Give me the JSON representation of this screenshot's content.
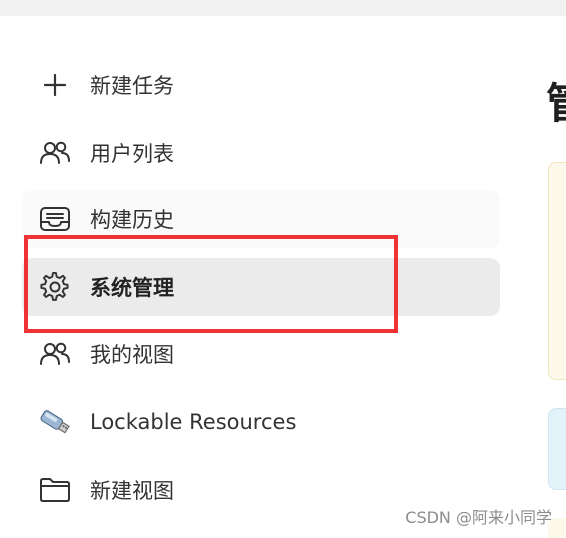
{
  "sidebar": {
    "items": [
      {
        "label": "新建任务",
        "icon": "plus-icon"
      },
      {
        "label": "用户列表",
        "icon": "users-icon"
      },
      {
        "label": "构建历史",
        "icon": "inbox-tray-icon"
      },
      {
        "label": "系统管理",
        "icon": "gear-icon",
        "active": true
      },
      {
        "label": "我的视图",
        "icon": "users-icon"
      },
      {
        "label": "Lockable Resources",
        "icon": "usb-drive-icon"
      },
      {
        "label": "新建视图",
        "icon": "folder-icon"
      }
    ]
  },
  "main": {
    "heading": "管"
  },
  "watermark": "CSDN @阿来小同学",
  "colors": {
    "highlight_border": "#ee3236",
    "active_bg": "#ebebeb",
    "info_card_yellow": "#fdf9ea",
    "info_card_blue": "#e4f3fa"
  }
}
